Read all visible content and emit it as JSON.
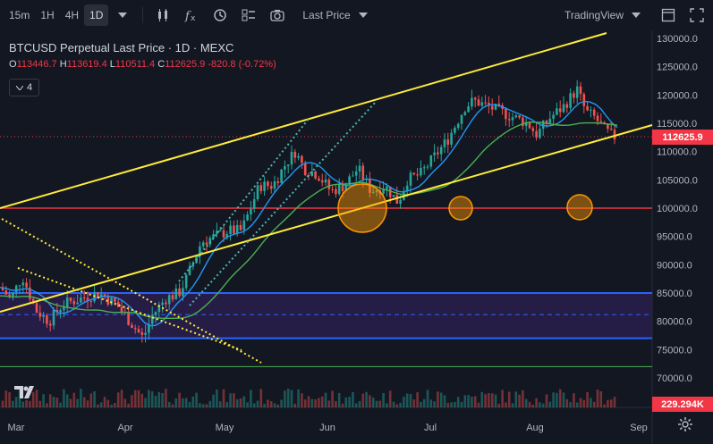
{
  "toolbar": {
    "intervals": [
      "15m",
      "1H",
      "4H",
      "1D"
    ],
    "active_interval": "1D",
    "price_type": "Last Price",
    "layout_name": "TradingView",
    "icons": [
      "chevron-down-icon",
      "candles-icon",
      "indicators-icon",
      "alert-icon",
      "templates-icon",
      "camera-icon",
      "maximize-icon",
      "fullscreen-icon"
    ]
  },
  "legend": {
    "title": "BTCUSD Perpetual Last Price · 1D · MEXC",
    "ohlc": [
      {
        "k": "O",
        "v": "113446.7"
      },
      {
        "k": "H",
        "v": "113619.4"
      },
      {
        "k": "L",
        "v": "110511.4"
      },
      {
        "k": "C",
        "v": "112625.9"
      }
    ],
    "change": "-820.8 (-0.72%)",
    "indicators_count": "4"
  },
  "chart_data": {
    "type": "candlestick",
    "y_ticks": [
      "130000.0",
      "125000.0",
      "120000.0",
      "115000.0",
      "110000.0",
      "105000.0",
      "100000.0",
      "95000.0",
      "90000.0",
      "85000.0",
      "80000.0",
      "75000.0",
      "70000.0"
    ],
    "x_ticks": [
      "Mar",
      "Apr",
      "May",
      "Jun",
      "Jul",
      "Aug",
      "Sep"
    ],
    "ylim": [
      70000,
      130000
    ],
    "last_price": "112625.9",
    "last_price_value": 112625.9,
    "volume_label": "229.294K",
    "horizontal_levels": [
      100000,
      85000,
      81200,
      77000,
      72000
    ],
    "colors": {
      "up": "#26a69a",
      "down": "#ef5350",
      "channel": "#ffeb3b",
      "support": "#f23645",
      "zone": "#2962ff",
      "ma_fast": "#2196f3",
      "ma_slow": "#4caf50",
      "highlight": "#ff9800"
    }
  }
}
